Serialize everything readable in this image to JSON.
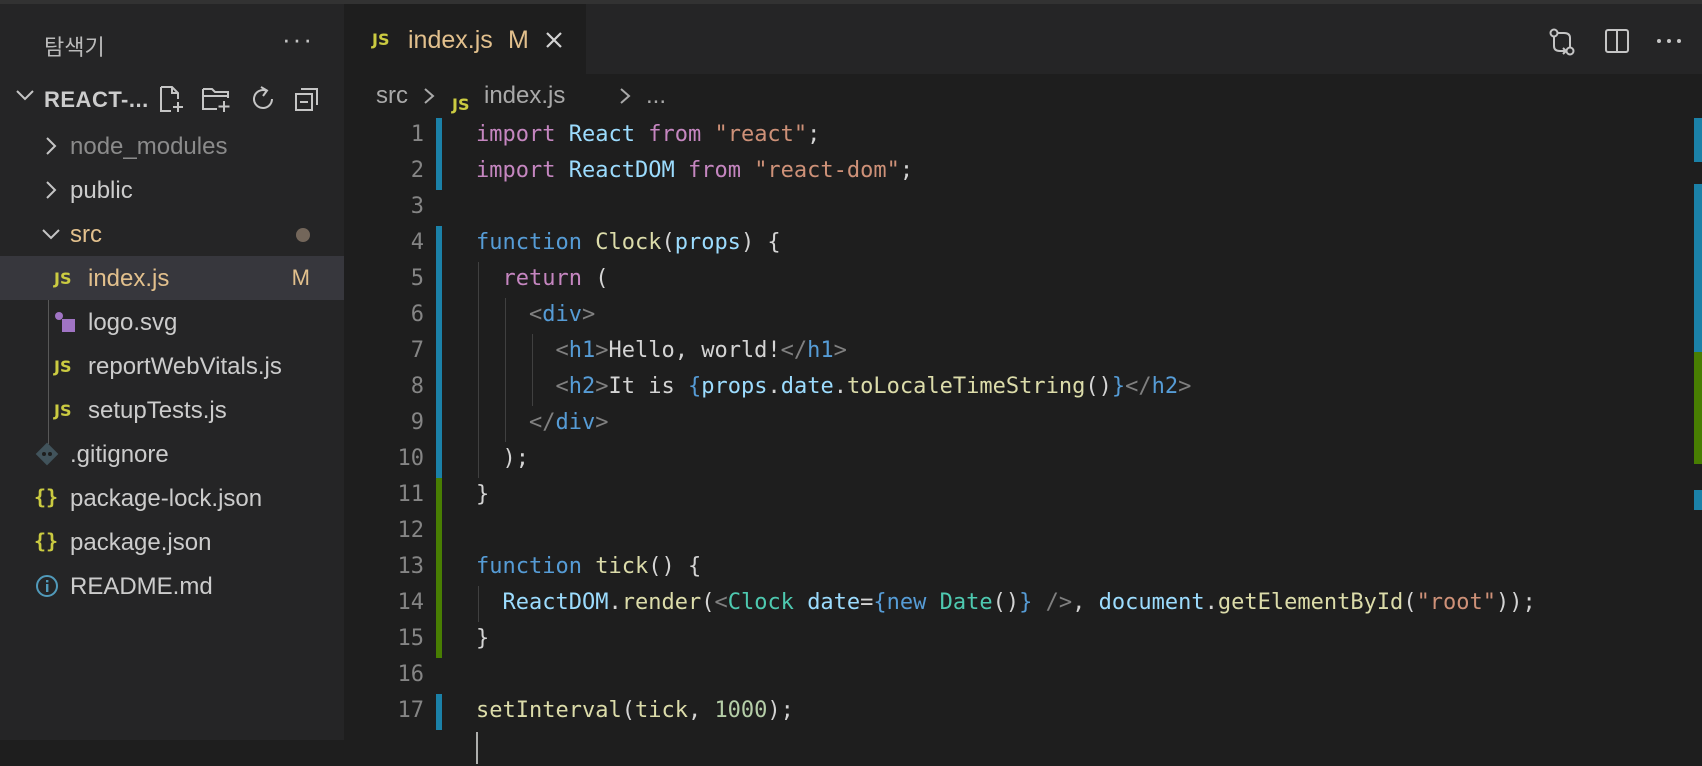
{
  "sidebar": {
    "title": "탐색기",
    "more": "···",
    "folder_name": "REACT-...",
    "items": [
      {
        "label": "node_modules",
        "icon": "chevron-right-icon",
        "color": "#8b8b8b"
      },
      {
        "label": "public",
        "icon": "chevron-right-icon"
      },
      {
        "label": "src",
        "icon": "chevron-down-icon",
        "color": "#e2c08d"
      },
      {
        "label": "index.js",
        "icon": "js-file-icon",
        "icon_text": "JS",
        "badge": "M",
        "color": "#e2c08d"
      },
      {
        "label": "logo.svg",
        "icon": "svg-file-icon"
      },
      {
        "label": "reportWebVitals.js",
        "icon": "js-file-icon",
        "icon_text": "JS"
      },
      {
        "label": "setupTests.js",
        "icon": "js-file-icon",
        "icon_text": "JS"
      },
      {
        "label": ".gitignore",
        "icon": "git-file-icon"
      },
      {
        "label": "package-lock.json",
        "icon": "json-file-icon",
        "icon_text": "{}"
      },
      {
        "label": "package.json",
        "icon": "json-file-icon",
        "icon_text": "{}"
      },
      {
        "label": "README.md",
        "icon": "info-file-icon"
      }
    ]
  },
  "tab": {
    "icon_text": "JS",
    "name": "index.js",
    "badge": "M"
  },
  "breadcrumb": {
    "folder": "src",
    "icon_text": "JS",
    "file": "index.js",
    "more": "..."
  },
  "code": {
    "line_numbers": [
      "1",
      "2",
      "3",
      "4",
      "5",
      "6",
      "7",
      "8",
      "9",
      "10",
      "11",
      "12",
      "13",
      "14",
      "15",
      "16",
      "17"
    ],
    "lines": [
      "import React from \"react\";",
      "import ReactDOM from \"react-dom\";",
      "",
      "function Clock(props) {",
      "  return (",
      "    <div>",
      "      <h1>Hello, world!</h1>",
      "      <h2>It is {props.date.toLocaleTimeString()}</h2>",
      "    </div>",
      "  );",
      "}",
      "",
      "function tick() {",
      "  ReactDOM.render(<Clock date={new Date()} />, document.getElementById(\"root\"));",
      "}",
      "",
      "setInterval(tick, 1000);"
    ]
  },
  "colors": {
    "modified_gutter": "#1b81a8",
    "added_gutter": "#487e02",
    "git_modified": "#e2c08d",
    "js_icon": "#cbcb41"
  }
}
